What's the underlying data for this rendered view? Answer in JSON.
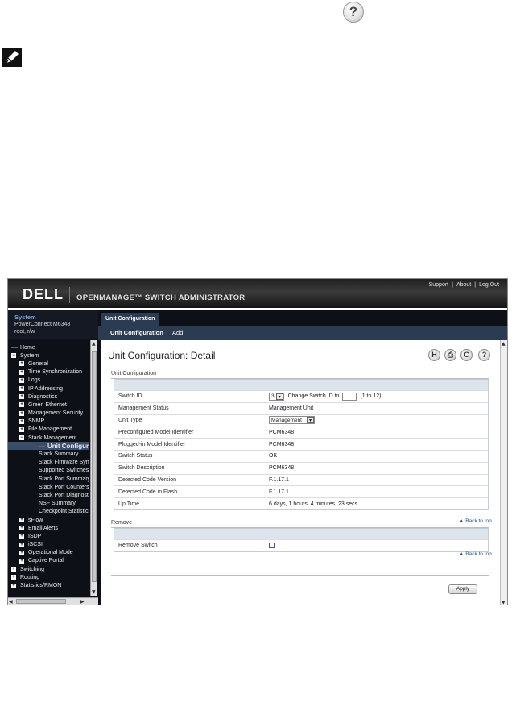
{
  "top_help_icon": "question-icon",
  "note_icon": "pencil-note-icon",
  "banner": {
    "logo": "DELL",
    "app_title": "OPENMANAGE™ SWITCH ADMINISTRATOR",
    "links": [
      "Support",
      "About",
      "Log Out"
    ],
    "separator": "|"
  },
  "system": {
    "title": "System",
    "model": "PowerConnect M6348",
    "user": "root, r/w"
  },
  "tree": [
    {
      "label": "Home",
      "level": 0,
      "icon": "line"
    },
    {
      "label": "System",
      "level": 0,
      "icon": "minus"
    },
    {
      "label": "General",
      "level": 1,
      "icon": "plus"
    },
    {
      "label": "Time Synchronization",
      "level": 1,
      "icon": "plus"
    },
    {
      "label": "Logs",
      "level": 1,
      "icon": "plus"
    },
    {
      "label": "IP Addressing",
      "level": 1,
      "icon": "plus"
    },
    {
      "label": "Diagnostics",
      "level": 1,
      "icon": "plus"
    },
    {
      "label": "Green Ethernet",
      "level": 1,
      "icon": "plus"
    },
    {
      "label": "Management Security",
      "level": 1,
      "icon": "plus"
    },
    {
      "label": "SNMP",
      "level": 1,
      "icon": "plus"
    },
    {
      "label": "File Management",
      "level": 1,
      "icon": "plus"
    },
    {
      "label": "Stack Management",
      "level": 1,
      "icon": "minus"
    },
    {
      "label": "Unit Configuration",
      "level": 3,
      "icon": "line",
      "selected": true
    },
    {
      "label": "Stack Summary",
      "level": 3,
      "icon": "none"
    },
    {
      "label": "Stack Firmware Synchronization",
      "level": 3,
      "icon": "none"
    },
    {
      "label": "Supported Switches",
      "level": 3,
      "icon": "none"
    },
    {
      "label": "Stack Port Summary",
      "level": 3,
      "icon": "none"
    },
    {
      "label": "Stack Port Counters",
      "level": 3,
      "icon": "none"
    },
    {
      "label": "Stack Port Diagnostics",
      "level": 3,
      "icon": "none"
    },
    {
      "label": "NSF Summary",
      "level": 3,
      "icon": "none"
    },
    {
      "label": "Checkpoint Statistics",
      "level": 3,
      "icon": "none"
    },
    {
      "label": "sFlow",
      "level": 1,
      "icon": "plus"
    },
    {
      "label": "Email Alerts",
      "level": 1,
      "icon": "plus"
    },
    {
      "label": "ISDP",
      "level": 1,
      "icon": "plus"
    },
    {
      "label": "iSCSI",
      "level": 1,
      "icon": "plus"
    },
    {
      "label": "Operational Mode",
      "level": 1,
      "icon": "plus"
    },
    {
      "label": "Captive Portal",
      "level": 1,
      "icon": "plus"
    },
    {
      "label": "Switching",
      "level": 0,
      "icon": "plus"
    },
    {
      "label": "Routing",
      "level": 0,
      "icon": "plus"
    },
    {
      "label": "Statistics/RMON",
      "level": 0,
      "icon": "plus"
    }
  ],
  "tabs": {
    "active": "Unit Configuration",
    "subtabs": [
      "Unit Configuration",
      "Add"
    ]
  },
  "page": {
    "title": "Unit Configuration: Detail",
    "toolbar_icons": [
      "save-icon",
      "print-icon",
      "refresh-icon",
      "help-icon"
    ],
    "toolbar_glyphs": [
      "H",
      "⎙",
      "C",
      "?"
    ],
    "section_title": "Unit Configuration",
    "switch_id": {
      "label": "Switch ID",
      "selected": "3",
      "change_label": "Change Switch ID to",
      "change_value": "",
      "range": "(1 to 12)"
    },
    "rows": [
      {
        "label": "Management Status",
        "value": "Management Unit"
      },
      {
        "label": "Unit Type",
        "value": "Management",
        "control": "select"
      },
      {
        "label": "Preconfigured Model Identifier",
        "value": "PCM6348"
      },
      {
        "label": "Plugged-in Model Identifier",
        "value": "PCM6348"
      },
      {
        "label": "Switch Status",
        "value": "OK"
      },
      {
        "label": "Switch Description",
        "value": "PCM6348"
      },
      {
        "label": "Detected Code Version",
        "value": "F.1.17.1"
      },
      {
        "label": "Detected Code in Flash",
        "value": "F.1.17.1"
      },
      {
        "label": "Up Time",
        "value": "6 days, 1 hours, 4 minutes, 23 secs"
      }
    ],
    "remove_section_title": "Remove",
    "back_to_top": "▲ Back to top",
    "remove_switch_label": "Remove Switch",
    "remove_switch_checked": false,
    "apply_label": "Apply"
  }
}
